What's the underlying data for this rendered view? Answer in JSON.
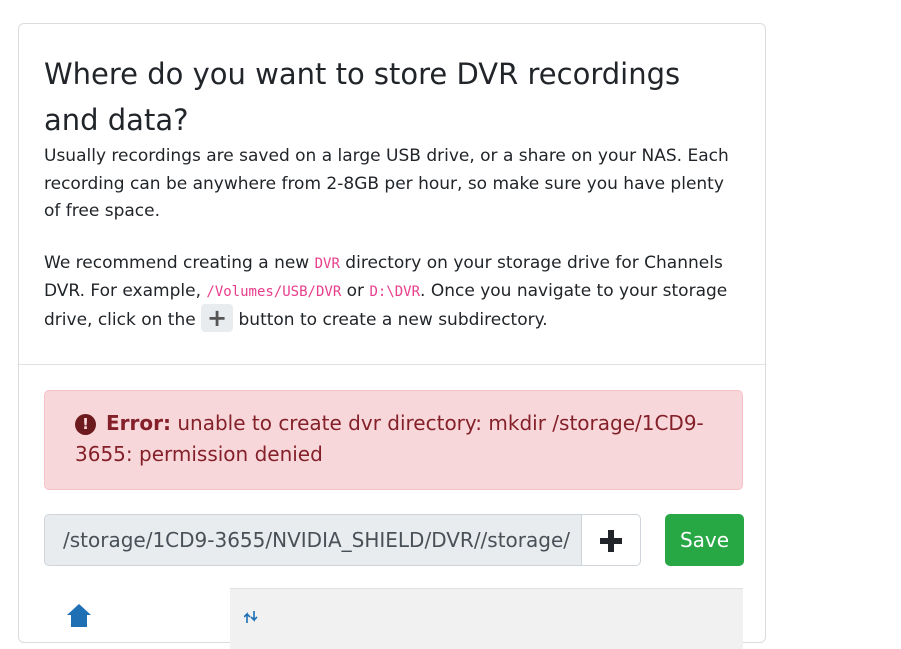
{
  "heading": {
    "title": "Where do you want to store DVR recordings and data?",
    "intro": "Usually recordings are saved on a large USB drive, or a share on your NAS. Each recording can be anywhere from 2-8GB per hour, so make sure you have plenty of free space.",
    "rec_1": "We recommend creating a new ",
    "rec_code_1": "DVR",
    "rec_2": " directory on your storage drive for Channels DVR. For example, ",
    "rec_code_2": "/Volumes/USB/DVR",
    "rec_3": " or ",
    "rec_code_3": "D:\\DVR",
    "rec_4": ". Once you navigate to your storage drive, click on the ",
    "rec_5": " button to create a new subdirectory."
  },
  "error": {
    "label": "Error:",
    "message": " unable to create dvr directory: mkdir /storage/1CD9-3655: permission denied",
    "color": "#842029"
  },
  "path_bar": {
    "value": "/storage/1CD9-3655/NVIDIA_SHIELD/DVR//storage/",
    "save_label": "Save",
    "save_color": "#28a745"
  },
  "icons": {
    "error": "exclamation-circle-icon",
    "add": "plus-icon",
    "home": "home-icon",
    "sort": "sort-icon"
  }
}
